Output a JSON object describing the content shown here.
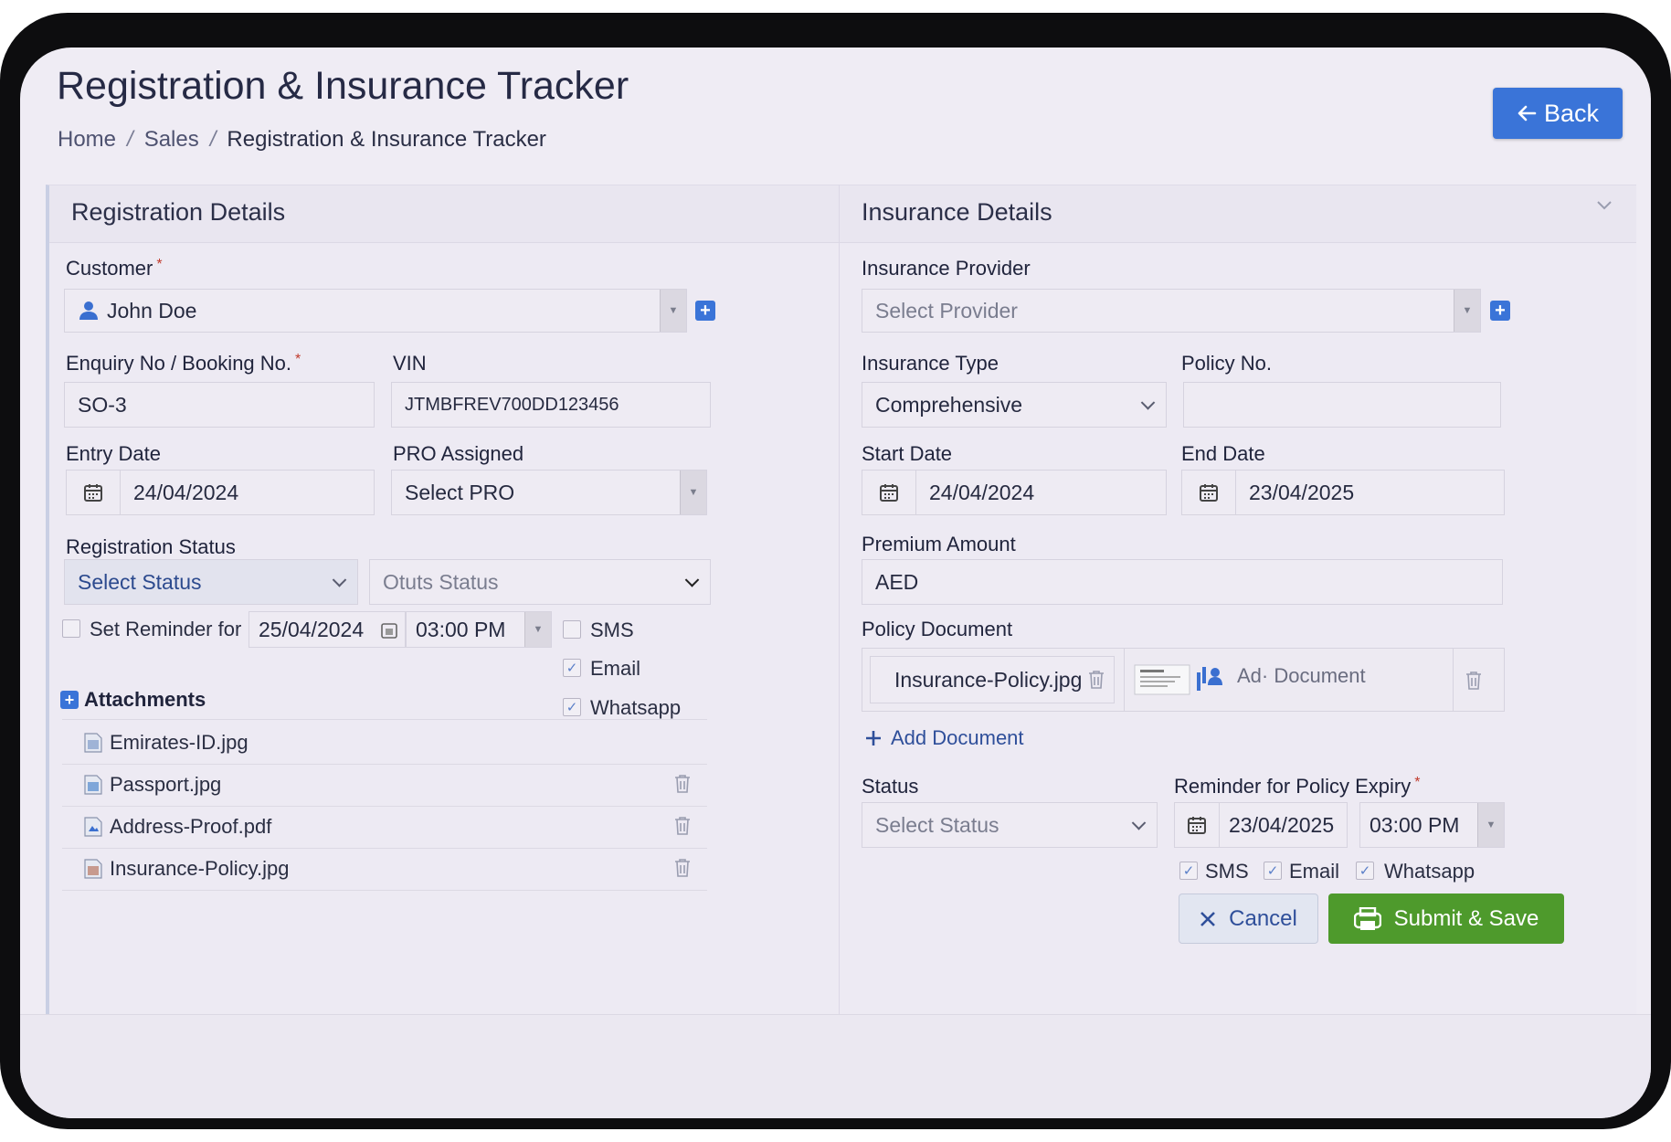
{
  "header": {
    "title": "Registration & Insurance Tracker",
    "breadcrumb": [
      "Home",
      "Sales",
      "Registration & Insurance Tracker"
    ],
    "breadcrumb_sep": "/",
    "back_label": "Back"
  },
  "registration": {
    "title": "Registration Details",
    "customer_label": "Customer",
    "customer_value": "John Doe",
    "enquiry_label": "Enquiry No / Booking No.",
    "enquiry_value": "SO-3",
    "vin_label": "VIN",
    "vin_value": "JTMBFREV700DD123456",
    "entry_date_label": "Entry Date",
    "entry_date_value": "24/04/2024",
    "pro_label": "PRO Assigned",
    "pro_placeholder": "Select PRO",
    "reg_status_label": "Registration Status",
    "status_placeholder": "Select Status",
    "outs_status_placeholder": "Otuts Status",
    "reminder_label": "Set Reminder for",
    "reminder_date": "25/04/2024",
    "reminder_time": "03:00 PM",
    "notify": [
      {
        "label": "SMS",
        "checked": false
      },
      {
        "label": "Email",
        "checked": true
      },
      {
        "label": "Whatsapp",
        "checked": true
      }
    ],
    "attachments_label": "Attachments",
    "attachments": [
      "Emirates-ID.jpg",
      "Passport.jpg",
      "Address-Proof.pdf",
      "Insurance-Policy.jpg"
    ]
  },
  "insurance": {
    "title": "Insurance Details",
    "provider_label": "Insurance Provider",
    "provider_placeholder": "Select Provider",
    "type_label": "Insurance Type",
    "type_value": "Comprehensive",
    "policy_no_label": "Policy No.",
    "policy_no_value": "",
    "start_label": "Start Date",
    "start_value": "24/04/2024",
    "end_label": "End Date",
    "end_value": "23/04/2025",
    "premium_label": "Premium Amount",
    "premium_value": "AED",
    "policy_doc_label": "Policy Document",
    "policy_doc_file": "Insurance-Policy.jpg",
    "doc_preview_text": "Ad· Document",
    "add_document_label": "Add Document",
    "status_label": "Status",
    "status_placeholder": "Select Status",
    "expiry_label": "Reminder for Policy Expiry",
    "expiry_date": "23/04/2025",
    "expiry_time": "03:00 PM",
    "notify": [
      {
        "label": "SMS",
        "checked": true
      },
      {
        "label": "Email",
        "checked": true
      },
      {
        "label": "Whatsapp",
        "checked": true
      }
    ]
  },
  "footer": {
    "cancel_label": "Cancel",
    "submit_label": "Submit & Save"
  },
  "colors": {
    "primary": "#3a74d8",
    "success": "#4e9a2c",
    "required": "#c0392b",
    "background": "#efecf4"
  },
  "icons": [
    "arrow-left-icon",
    "user-icon",
    "plus-icon",
    "calendar-icon",
    "chevron-down-icon",
    "trash-icon",
    "file-icon",
    "close-icon",
    "save-icon"
  ]
}
